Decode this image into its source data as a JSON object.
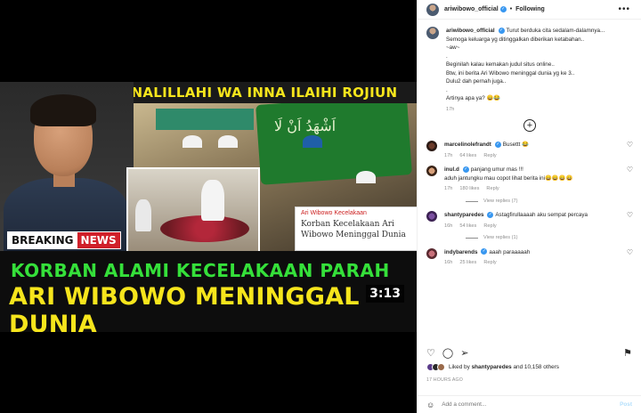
{
  "video": {
    "banner": "INALILLAHI WA INNA ILAIHI ROJIUN",
    "arabic_text": "اَشْهَدُ اَنْ لَا",
    "news_card_tag": "Ari Wibowo Kecelakaan",
    "news_card_title": "Korban Kecelakaan Ari Wibowo Meninggal Dunia",
    "breaking_1": "BREAKING",
    "breaking_2": "NEWS",
    "headline_1": "KORBAN ALAMI KECELAKAAN PARAH",
    "headline_2": "ARI WIBOWO MENINGGAL DUNIA",
    "duration": "3:13"
  },
  "header": {
    "username": "ariwibowo_official",
    "separator": "•",
    "follow_label": "Following",
    "more_label": "•••"
  },
  "caption": {
    "username": "ariwibowo_official",
    "text": "Turut berduka cita sedalam-dalamnya...\nSemoga keluarga yg ditinggalkan diberikan ketabahan..\n~aw~\n.\nBeginilah kalau kemakan judul situs online..\nBtw, ini berita Ari Wibowo meninggal dunia yg ke 3..\nDulu2 dah pernah juga..\n.\nArtinya apa ya? 😄😂",
    "time": "17h"
  },
  "comments": [
    {
      "username": "marcelinolefrandt",
      "text": "Busettt 😂",
      "time": "17h",
      "likes": "64 likes",
      "reply": "Reply"
    },
    {
      "username": "inul.d",
      "text": "panjang umur mas !!!\naduh jantungku mau copot lihat berita ini😄😄😄😄",
      "time": "17h",
      "likes": "180 likes",
      "reply": "Reply",
      "view_replies": "View replies (7)"
    },
    {
      "username": "shantyparedes",
      "text": "Astagfirullaaaah aku sempat percaya",
      "time": "16h",
      "likes": "54 likes",
      "reply": "Reply",
      "view_replies": "View replies (1)"
    },
    {
      "username": "indybarends",
      "text": "aaah paraaaaah",
      "time": "16h",
      "likes": "25 likes",
      "reply": "Reply"
    }
  ],
  "likes": {
    "prefix": "Liked by",
    "user": "shantyparedes",
    "suffix": "and 10,158 others"
  },
  "time_ago": "17 HOURS AGO",
  "add_comment": {
    "placeholder": "Add a comment...",
    "post_label": "Post"
  },
  "colors": {
    "verified": "#3897f0",
    "headline_green": "#35e03a",
    "headline_yellow": "#f6e51c",
    "breaking_red": "#d0202a"
  }
}
